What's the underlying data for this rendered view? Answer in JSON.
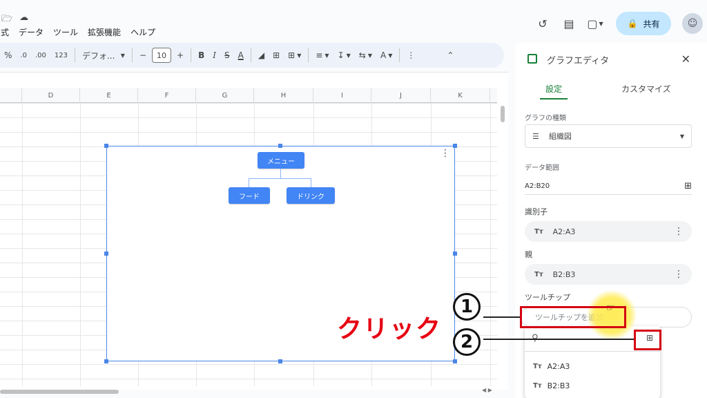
{
  "menubar": {
    "items": [
      "式",
      "データ",
      "ツール",
      "拡張機能",
      "ヘルプ"
    ]
  },
  "header": {
    "share_label": "共有"
  },
  "toolbar": {
    "percent": "%",
    "dec_decrease": ".0",
    "dec_increase": ".00",
    "number_format": "123",
    "font_name": "デフォ...",
    "font_size": "10",
    "minus": "−",
    "plus": "+",
    "bold": "B",
    "italic": "I",
    "strike": "S",
    "text_color": "A"
  },
  "sheet": {
    "columns": [
      "D",
      "E",
      "F",
      "G",
      "H",
      "I",
      "J",
      "K"
    ]
  },
  "chart": {
    "root_node": "メニュー",
    "child_nodes": [
      "フード",
      "ドリンク"
    ]
  },
  "panel": {
    "title": "グラフエディタ",
    "tabs": [
      "設定",
      "カスタマイズ"
    ],
    "chart_type_label": "グラフの種類",
    "chart_type_value": "組織図",
    "data_range_label": "データ範囲",
    "data_range_value": "A2:B20",
    "identifier_label": "識別子",
    "identifier_value": "A2:A3",
    "parent_label": "親",
    "parent_value": "B2:B3",
    "tooltip_label": "ツールチップ",
    "tooltip_placeholder": "ツールチップを追加",
    "dropdown_items": [
      "A2:A3",
      "B2:B3"
    ],
    "chip_icon_text": "Tт"
  },
  "annotations": {
    "click_label": "クリック",
    "step1": "1",
    "step2": "2"
  }
}
